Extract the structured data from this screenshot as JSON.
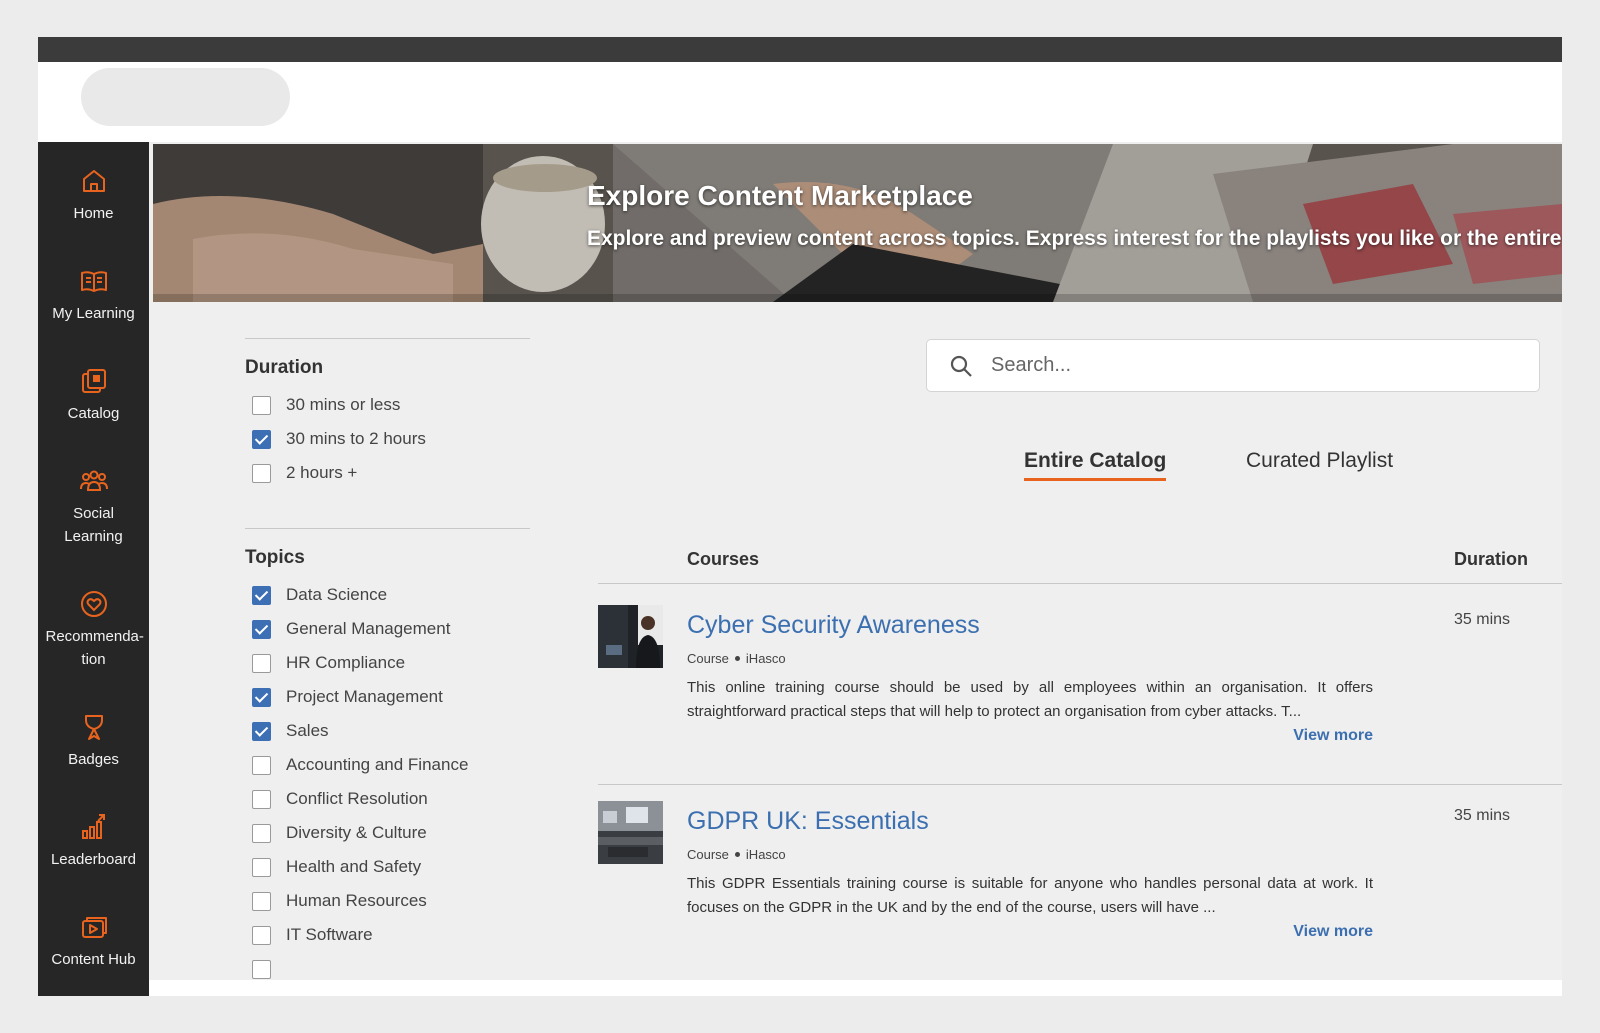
{
  "nav": {
    "items": [
      {
        "label": "Home",
        "icon": "home-icon"
      },
      {
        "label": "My Learning",
        "icon": "open-book-icon"
      },
      {
        "label": "Catalog",
        "icon": "catalog-icon"
      },
      {
        "label": "Social Learning",
        "icon": "people-group-icon"
      },
      {
        "label": "Recommenda-tion",
        "icon": "heart-badge-icon"
      },
      {
        "label": "Badges",
        "icon": "trophy-icon"
      },
      {
        "label": "Leaderboard",
        "icon": "bar-chart-icon"
      },
      {
        "label": "Content Hub",
        "icon": "video-library-icon"
      }
    ],
    "accent_color": "#e8641e"
  },
  "banner": {
    "title": "Explore Content Marketplace",
    "subtitle": "Explore and preview content across topics. Express interest for the playlists you like or the entire ca"
  },
  "filters": {
    "duration": {
      "title": "Duration",
      "options": [
        {
          "label": "30 mins or less",
          "checked": false
        },
        {
          "label": "30 mins to 2 hours",
          "checked": true
        },
        {
          "label": "2 hours +",
          "checked": false
        }
      ]
    },
    "topics": {
      "title": "Topics",
      "options": [
        {
          "label": "Data Science",
          "checked": true
        },
        {
          "label": "General Management",
          "checked": true
        },
        {
          "label": "HR Compliance",
          "checked": false
        },
        {
          "label": "Project Management",
          "checked": true
        },
        {
          "label": "Sales",
          "checked": true
        },
        {
          "label": "Accounting and Finance",
          "checked": false
        },
        {
          "label": "Conflict Resolution",
          "checked": false
        },
        {
          "label": "Diversity & Culture",
          "checked": false
        },
        {
          "label": "Health and Safety",
          "checked": false
        },
        {
          "label": "Human Resources",
          "checked": false
        },
        {
          "label": "IT Software",
          "checked": false
        }
      ]
    }
  },
  "search": {
    "placeholder": "Search..."
  },
  "tabs": [
    {
      "label": "Entire Catalog",
      "active": true
    },
    {
      "label": "Curated Playlist",
      "active": false
    }
  ],
  "list": {
    "courses_header": "Courses",
    "duration_header": "Duration",
    "courses": [
      {
        "title": "Cyber Security Awareness",
        "type": "Course",
        "provider": "iHasco",
        "description": "This online training course should be used by all employees within an organisation. It offers straightforward practical steps that will help to protect an organisation from cyber attacks. T...",
        "view_more": "View more",
        "duration": "35 mins"
      },
      {
        "title": "GDPR UK: Essentials",
        "type": "Course",
        "provider": "iHasco",
        "description": "This GDPR Essentials training course is suitable for anyone who handles personal data at work. It focuses on the GDPR in the UK and by the end of the course, users will have ...",
        "view_more": "View more",
        "duration": "35 mins"
      }
    ]
  }
}
